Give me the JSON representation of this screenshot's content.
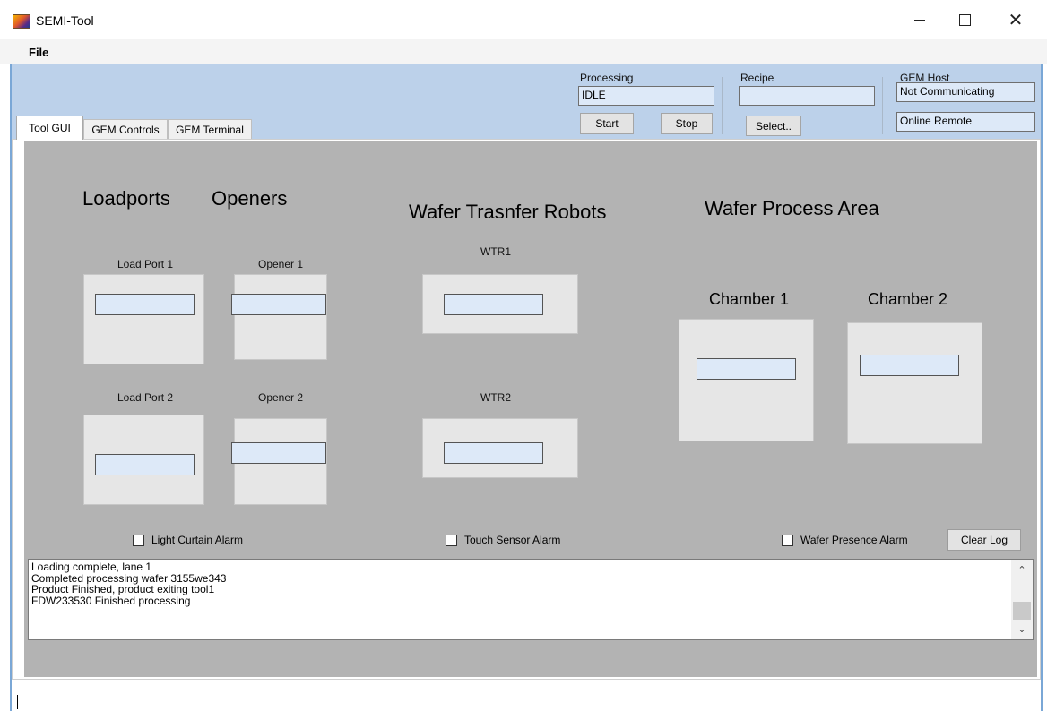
{
  "window": {
    "title": "SEMI-Tool"
  },
  "menu": {
    "file": "File"
  },
  "processing": {
    "label": "Processing",
    "status": "IDLE",
    "start": "Start",
    "stop": "Stop"
  },
  "recipe": {
    "label": "Recipe",
    "value": "",
    "select": "Select.."
  },
  "gem_host": {
    "label": "GEM Host",
    "communication": "Not Communicating",
    "control_state": "Online Remote"
  },
  "tabs": [
    "Tool GUI",
    "GEM Controls",
    "GEM Terminal"
  ],
  "sections": {
    "loadports": "Loadports",
    "openers": "Openers",
    "robots": "Wafer Trasnfer Robots",
    "process": "Wafer Process Area"
  },
  "stations": {
    "load_port_1": "Load Port 1",
    "load_port_2": "Load Port 2",
    "opener_1": "Opener 1",
    "opener_2": "Opener 2",
    "wtr1": "WTR1",
    "wtr2": "WTR2",
    "chamber_1": "Chamber 1",
    "chamber_2": "Chamber 2"
  },
  "alarms": {
    "light_curtain": "Light Curtain Alarm",
    "touch_sensor": "Touch Sensor Alarm",
    "wafer_presence": "Wafer Presence Alarm"
  },
  "clear_log": "Clear Log",
  "log": [
    "Loading complete, lane 1",
    "Completed processing wafer  3155we343",
    "Product Finished, product exiting tool1",
    "FDW233530 Finished processing"
  ],
  "icons": {
    "app": "app-icon",
    "minimize": "minimize-icon",
    "maximize": "maximize-icon",
    "close": "close-icon"
  },
  "colors": {
    "band": "#bcd1ea",
    "panel": "#b3b3b3",
    "field": "#dde9f8"
  }
}
